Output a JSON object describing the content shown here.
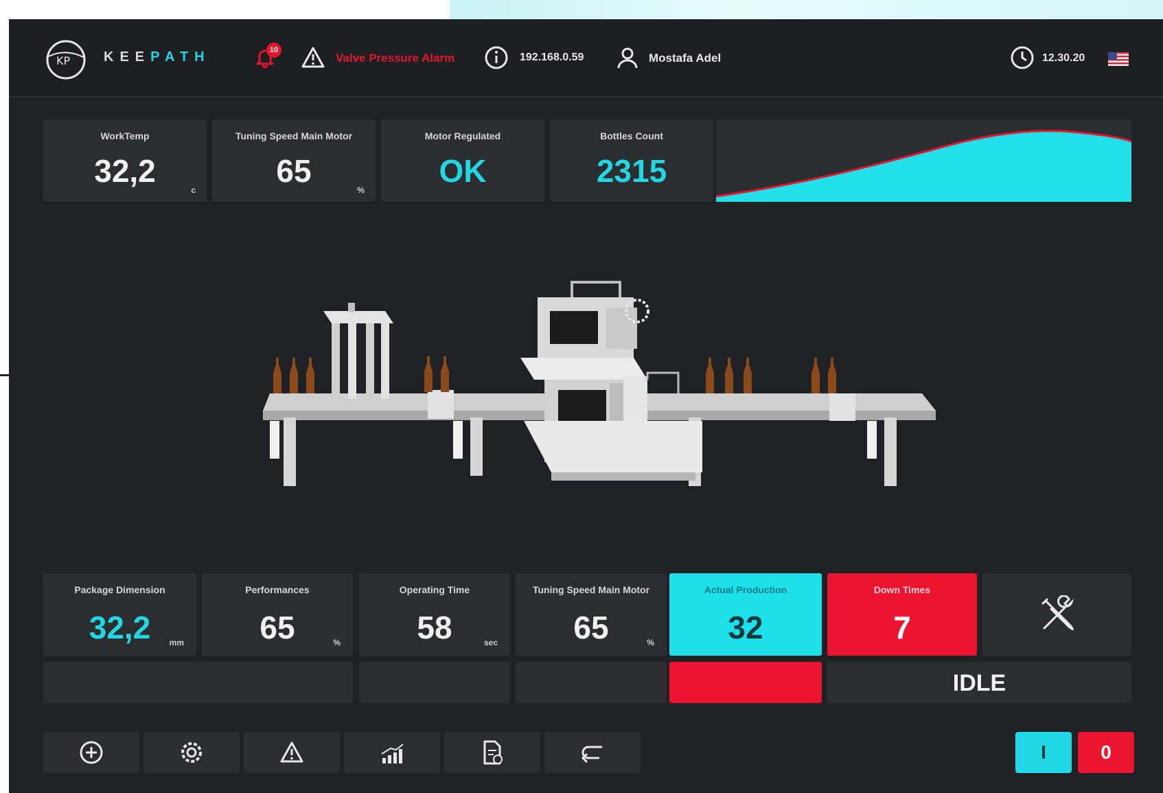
{
  "header": {
    "logo_text_a": "KEE",
    "logo_text_b": "PATH",
    "notification_count": "10",
    "alarm_text": "Valve Pressure Alarm",
    "ip": "192.168.0.59",
    "user": "Mostafa Adel",
    "time": "12.30.20"
  },
  "top_cards": [
    {
      "label": "WorkTemp",
      "value": "32,2",
      "unit": "c"
    },
    {
      "label": "Tuning Speed Main Motor",
      "value": "65",
      "unit": "%"
    },
    {
      "label": "Motor Regulated",
      "value": "OK",
      "unit": ""
    },
    {
      "label": "Bottles Count",
      "value": "2315",
      "unit": ""
    }
  ],
  "bottom_cards": [
    {
      "label": "Package Dimension",
      "value": "32,2",
      "unit": "mm"
    },
    {
      "label": "Performances",
      "value": "65",
      "unit": "%"
    },
    {
      "label": "Operating Time",
      "value": "58",
      "unit": "sec"
    },
    {
      "label": "Tuning Speed Main Motor",
      "value": "65",
      "unit": "%"
    },
    {
      "label": "Actual Production",
      "value": "32",
      "unit": ""
    },
    {
      "label": "Down Times",
      "value": "7",
      "unit": ""
    }
  ],
  "status": "IDLE",
  "toolbar": [
    "add-icon",
    "settings-icon",
    "warning-icon",
    "chart-icon",
    "report-icon",
    "back-icon"
  ],
  "switch": {
    "on_label": "I",
    "off_label": "0"
  },
  "colors": {
    "accent": "#22d6e3",
    "alert": "#ec1530",
    "bg": "#202124",
    "card": "#2c2d31"
  }
}
